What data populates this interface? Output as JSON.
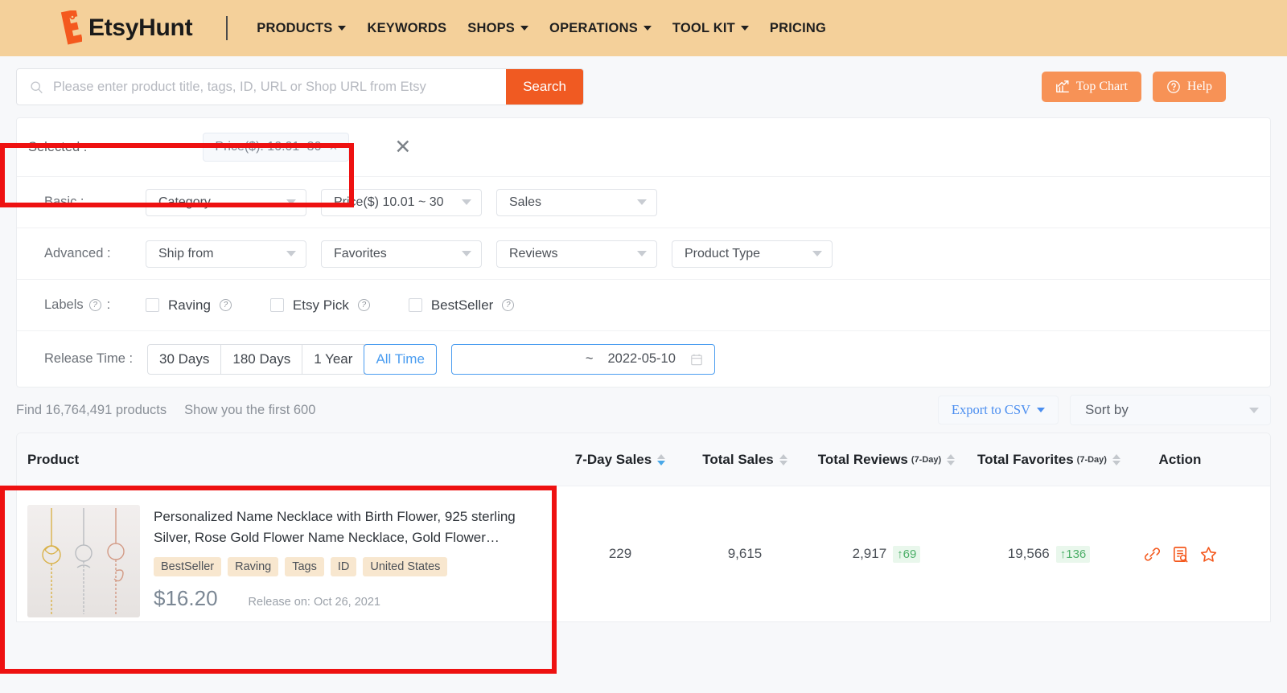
{
  "header": {
    "brand": "EtsyHunt",
    "nav": [
      {
        "label": "PRODUCTS",
        "caret": true
      },
      {
        "label": "KEYWORDS",
        "caret": false
      },
      {
        "label": "SHOPS",
        "caret": true
      },
      {
        "label": "OPERATIONS",
        "caret": true
      },
      {
        "label": "TOOL KIT",
        "caret": true
      },
      {
        "label": "PRICING",
        "caret": false
      }
    ],
    "colors": {
      "bar_bg": "#f4d09a",
      "accent": "#f05a22"
    }
  },
  "search": {
    "placeholder": "Please enter product title, tags, ID, URL or Shop URL from Etsy",
    "button_label": "Search",
    "icon": "search-icon",
    "top_chart_label": "Top Chart",
    "top_chart_icon": "bar-chart-icon",
    "help_label": "Help",
    "help_icon": "question-circle-icon"
  },
  "filters": {
    "selected_label": "Selected :",
    "selected_chips": [
      {
        "label": "Price($): 10.01~30",
        "close": "×"
      }
    ],
    "clear_all_icon": "close-icon",
    "basic_label": "Basic :",
    "basic": [
      {
        "name": "category",
        "value": "Category"
      },
      {
        "name": "price",
        "value": "Price($) 10.01 ~ 30"
      },
      {
        "name": "sales",
        "value": "Sales"
      }
    ],
    "advanced_label": "Advanced :",
    "advanced": [
      {
        "name": "ship-from",
        "value": "Ship from"
      },
      {
        "name": "favorites",
        "value": "Favorites"
      },
      {
        "name": "reviews",
        "value": "Reviews"
      },
      {
        "name": "product-type",
        "value": "Product Type"
      }
    ],
    "labels_label": "Labels",
    "labels_colon": ":",
    "label_options": [
      {
        "name": "raving",
        "label": "Raving",
        "checked": false
      },
      {
        "name": "etsy-pick",
        "label": "Etsy Pick",
        "checked": false
      },
      {
        "name": "bestseller",
        "label": "BestSeller",
        "checked": false
      }
    ],
    "release_time_label": "Release Time :",
    "release_segments": [
      {
        "label": "30 Days",
        "active": false
      },
      {
        "label": "180 Days",
        "active": false
      },
      {
        "label": "1 Year",
        "active": false
      },
      {
        "label": "All Time",
        "active": true
      }
    ],
    "date_range": {
      "separator": "~",
      "end_date": "2022-05-10",
      "icon": "calendar-icon"
    }
  },
  "results": {
    "found_text": "Find 16,764,491 products",
    "show_text": "Show you the first 600",
    "export_label": "Export to CSV",
    "sort_placeholder": "Sort by"
  },
  "table": {
    "columns": [
      {
        "key": "product",
        "label": "Product",
        "sub": "",
        "sortable": false,
        "sort_active": false
      },
      {
        "key": "seven_day_sales",
        "label": "7-Day Sales",
        "sub": "",
        "sortable": true,
        "sort_active": true
      },
      {
        "key": "total_sales",
        "label": "Total Sales",
        "sub": "",
        "sortable": true,
        "sort_active": false
      },
      {
        "key": "total_reviews",
        "label": "Total Reviews",
        "sub": "(7-Day)",
        "sortable": true,
        "sort_active": false
      },
      {
        "key": "total_favorites",
        "label": "Total Favorites",
        "sub": "(7-Day)",
        "sortable": true,
        "sort_active": false
      },
      {
        "key": "action",
        "label": "Action",
        "sub": "",
        "sortable": false,
        "sort_active": false
      }
    ],
    "rows": [
      {
        "title": "Personalized Name Necklace with Birth Flower, 925 sterling Silver, Rose Gold Flower Name Necklace, Gold Flower…",
        "tags": [
          "BestSeller",
          "Raving",
          "Tags",
          "ID",
          "United States"
        ],
        "price": "$16.20",
        "release": "Release on: Oct 26, 2021",
        "seven_day_sales": "229",
        "total_sales": "9,615",
        "total_reviews": "2,917",
        "total_reviews_delta": "↑69",
        "total_favorites": "19,566",
        "total_favorites_delta": "↑136",
        "actions": [
          "link-icon",
          "document-search-icon",
          "star-icon"
        ]
      }
    ]
  },
  "annotations": {
    "highlight_color": "#ee1111",
    "boxes": [
      "selected-filter-row",
      "product-column"
    ]
  }
}
